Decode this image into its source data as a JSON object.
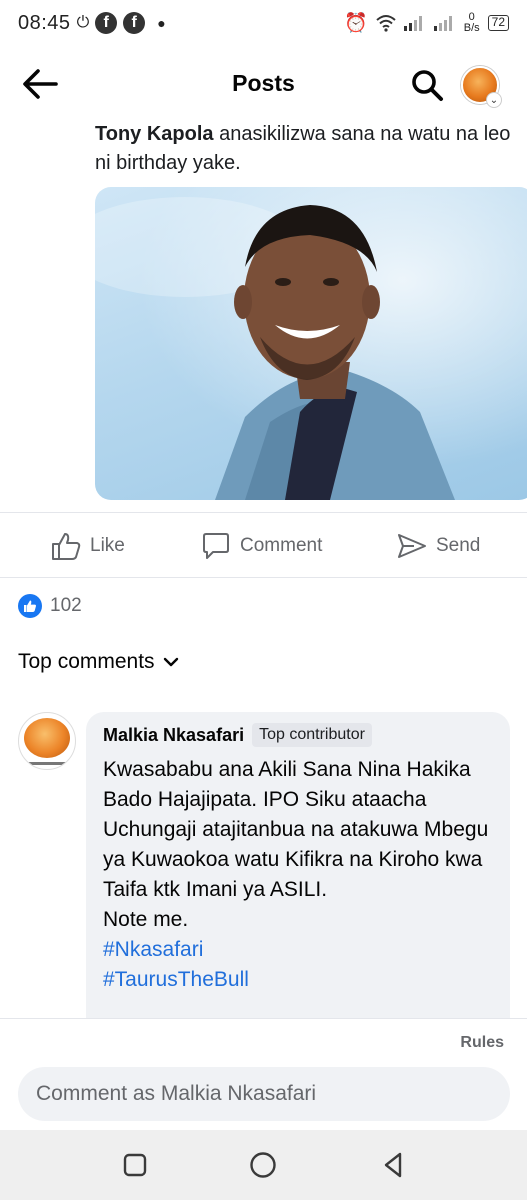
{
  "status_bar": {
    "time": "08:45",
    "speed_value": "0",
    "speed_unit": "B/s",
    "battery": "72"
  },
  "app_bar": {
    "title": "Posts"
  },
  "post": {
    "author": "Tony Kapola",
    "text": " anasikilizwa sana na watu na leo ni birthday yake."
  },
  "actions": {
    "like": "Like",
    "comment": "Comment",
    "send": "Send"
  },
  "reactions": {
    "count": "102"
  },
  "comments_section": {
    "filter_label": "Top comments"
  },
  "comment": {
    "author": "Malkia Nkasafari",
    "badge": "Top contributor",
    "text": "Kwasababu ana Akili Sana Nina Hakika Bado Hajajipata.  IPO Siku ataacha Uchungaji atajitanbua na atakuwa Mbegu ya Kuwaokoa watu Kifikra na Kiroho kwa Taifa  ktk Imani ya ASILI.\nNote me.",
    "hashtags": [
      "#Nkasafari",
      "#TaurusTheBull"
    ]
  },
  "composer": {
    "rules": "Rules",
    "placeholder": "Comment as Malkia Nkasafari"
  },
  "colors": {
    "accent": "#1877f2",
    "hashtag": "#216fdb",
    "secondary_text": "#65676b",
    "bubble": "#f0f2f5"
  }
}
